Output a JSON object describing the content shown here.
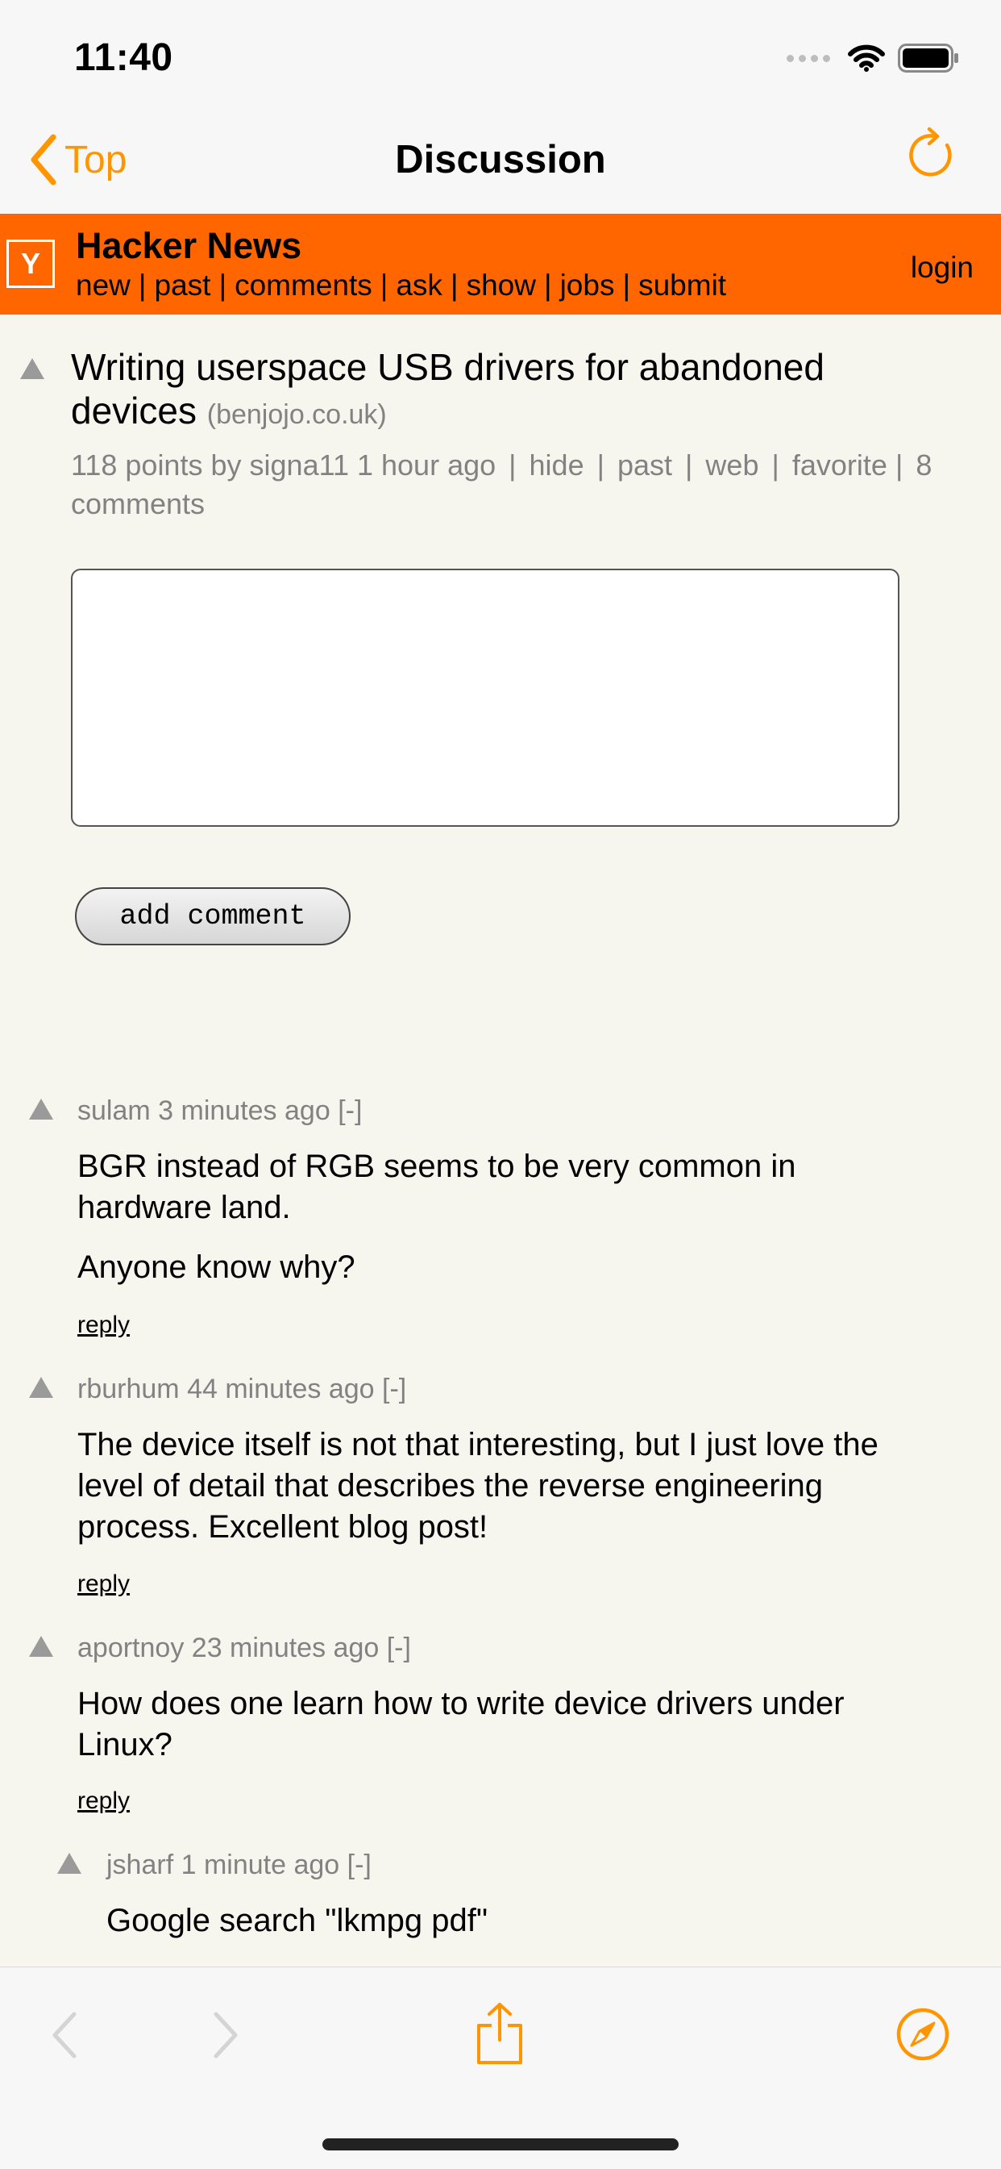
{
  "status_bar": {
    "time": "11:40"
  },
  "nav": {
    "back_label": "Top",
    "title": "Discussion"
  },
  "hn": {
    "logo": "Y",
    "title": "Hacker News",
    "links": [
      "new",
      "past",
      "comments",
      "ask",
      "show",
      "jobs",
      "submit"
    ],
    "login": "login"
  },
  "story": {
    "title": "Writing userspace USB drivers for abandoned devices",
    "domain": "(benjojo.co.uk)",
    "points": "118 points",
    "by_label": "by",
    "user": "signa11",
    "age": "1 hour ago",
    "actions": [
      "hide",
      "past",
      "web",
      "favorite"
    ],
    "comments": "8 comments"
  },
  "form": {
    "add_comment_label": "add comment"
  },
  "comments": [
    {
      "user": "sulam",
      "age": "3 minutes ago",
      "toggle": "[-]",
      "text1": "BGR instead of RGB seems to be very common in hardware land.",
      "text2": "Anyone know why?",
      "reply": "reply"
    },
    {
      "user": "rburhum",
      "age": "44 minutes ago",
      "toggle": "[-]",
      "text1": "The device itself is not that interesting, but I just love the level of detail that describes the reverse engineering process. Excellent blog post!",
      "reply": "reply"
    },
    {
      "user": "aportnoy",
      "age": "23 minutes ago",
      "toggle": "[-]",
      "text1": "How does one learn how to write device drivers under Linux?",
      "reply": "reply"
    },
    {
      "user": "jsharf",
      "age": "1 minute ago",
      "toggle": "[-]",
      "text1": "Google search \"lkmpg pdf\""
    }
  ],
  "colors": {
    "accent": "#ff9500",
    "hn_orange": "#ff6600",
    "meta_gray": "#828282",
    "page_bg": "#f6f6ef"
  }
}
